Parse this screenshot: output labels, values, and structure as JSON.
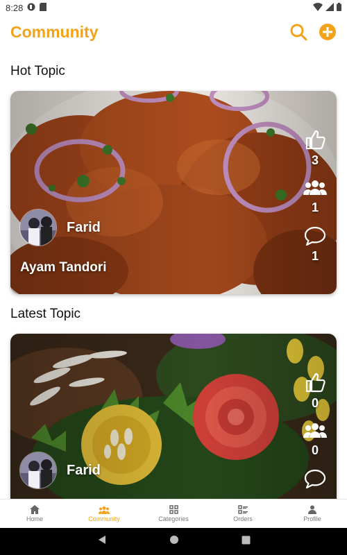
{
  "status_bar": {
    "time": "8:28"
  },
  "app_bar": {
    "title": "Community",
    "actions": [
      "search-icon",
      "add-circle-icon"
    ]
  },
  "hot_section": {
    "title": "Hot Topic",
    "card": {
      "author": "Farid",
      "topic": "Ayam Tandori",
      "likes": "3",
      "members": "1",
      "comments": "1"
    }
  },
  "latest_section": {
    "title": "Latest Topic",
    "card": {
      "author": "Farid",
      "likes": "0",
      "members": "0"
    }
  },
  "bottom_nav": [
    {
      "label": "Home",
      "icon": "home-icon"
    },
    {
      "label": "Community",
      "icon": "community-icon",
      "active": true
    },
    {
      "label": "Categories",
      "icon": "categories-icon"
    },
    {
      "label": "Orders",
      "icon": "orders-icon"
    },
    {
      "label": "Profile",
      "icon": "profile-icon"
    }
  ],
  "colors": {
    "accent": "#f2a31b",
    "text": "#111111",
    "nav_inactive": "#777777"
  }
}
